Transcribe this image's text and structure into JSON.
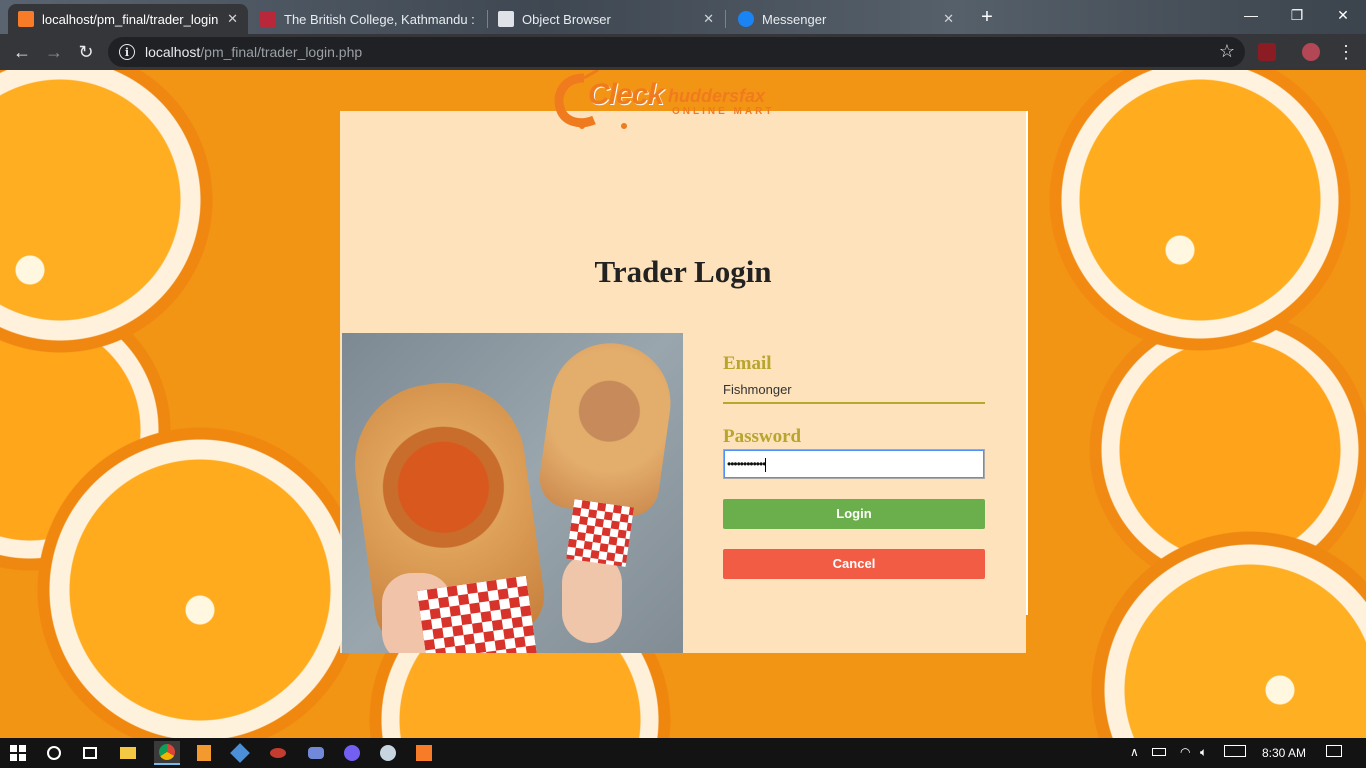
{
  "browser": {
    "tabs": [
      {
        "title": "localhost/pm_final/trader_login.php",
        "active": true,
        "favicon": "xampp-icon",
        "favicon_color": "#f87b28"
      },
      {
        "title": "The British College, Kathmandu :",
        "active": false,
        "favicon": "college-icon",
        "favicon_color": "#b8273a"
      },
      {
        "title": "Object Browser",
        "active": false,
        "favicon": "page-icon",
        "favicon_color": "#dfe3e8"
      },
      {
        "title": "Messenger",
        "active": false,
        "favicon": "messenger-icon",
        "favicon_color": "#1b84f5"
      }
    ],
    "new_tab": "+",
    "window_controls": {
      "minimize": "—",
      "maximize": "❐",
      "close": "✕"
    },
    "url_host": "localhost",
    "url_path": "/pm_final/trader_login.php",
    "nav": {
      "back": "←",
      "forward": "→",
      "reload": "↻"
    },
    "bookmark_icon": "star-icon",
    "menu": "⋮"
  },
  "page": {
    "logo": {
      "word_main": "Cleck",
      "word_brand": "huddersfax",
      "tagline": "ONLINE MART"
    },
    "title": "Trader Login",
    "email_label": "Email",
    "email_value": "Fishmonger",
    "password_label": "Password",
    "password_mask": "••••••••••••",
    "login_button": "Login",
    "cancel_button": "Cancel",
    "colors": {
      "login": "#6aaf4b",
      "cancel": "#f25c45",
      "label": "#b7a52c",
      "logo": "#f07a1e"
    }
  },
  "taskbar": {
    "time": "8:30 AM"
  }
}
